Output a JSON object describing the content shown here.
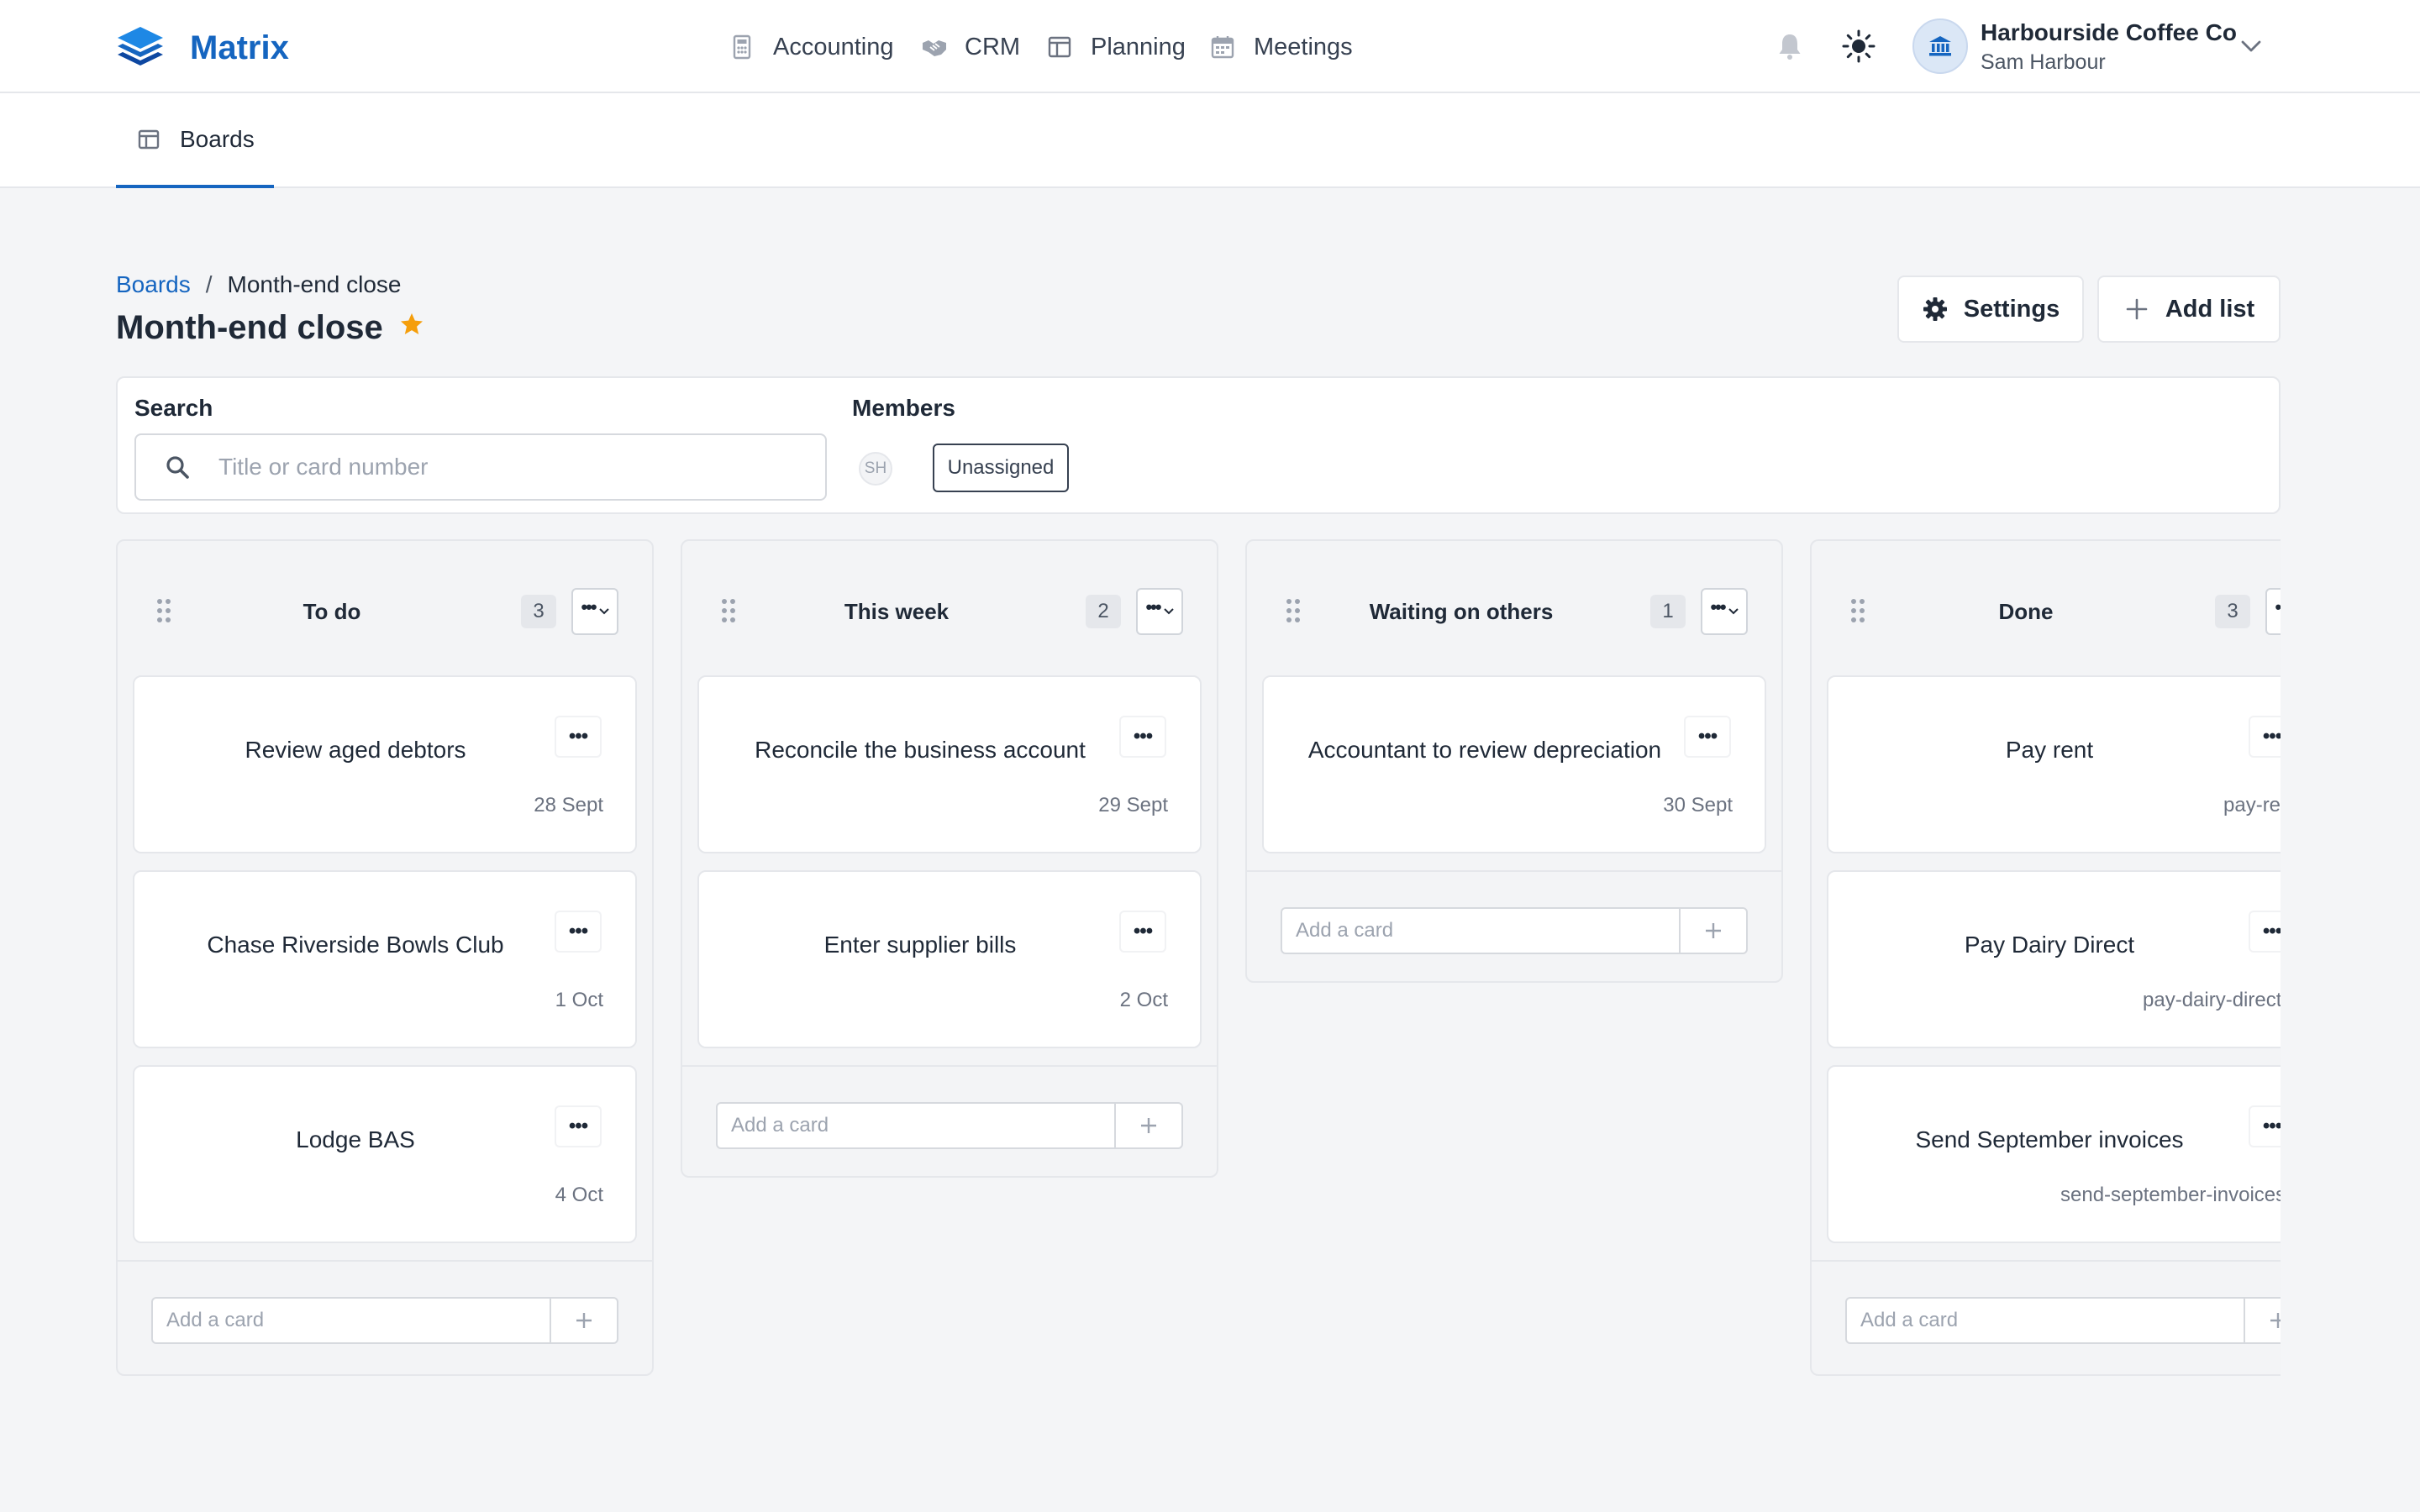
{
  "app": {
    "brand": "Matrix",
    "nav": [
      {
        "label": "Accounting",
        "icon": "calculator-icon"
      },
      {
        "label": "CRM",
        "icon": "handshake-icon"
      },
      {
        "label": "Planning",
        "icon": "layout-icon"
      },
      {
        "label": "Meetings",
        "icon": "calendar-icon"
      }
    ],
    "account": {
      "org": "Harbourside Coffee Co",
      "user": "Sam Harbour"
    }
  },
  "subnav": {
    "active_tab": "Boards"
  },
  "breadcrumb": {
    "parent": "Boards",
    "separator": "/",
    "current": "Month-end close"
  },
  "page": {
    "title": "Month-end close",
    "starred": true,
    "settings_label": "Settings",
    "add_list_label": "Add list"
  },
  "filters": {
    "search_label": "Search",
    "search_placeholder": "Title or card number",
    "members_label": "Members",
    "member_initials": "SH",
    "unassigned_label": "Unassigned"
  },
  "add_card_placeholder": "Add a card",
  "columns": [
    {
      "title": "To do",
      "count": "3",
      "cards": [
        {
          "title": "Review aged debtors",
          "meta": "28 Sept"
        },
        {
          "title": "Chase Riverside Bowls Club",
          "meta": "1 Oct"
        },
        {
          "title": "Lodge BAS",
          "meta": "4 Oct"
        }
      ]
    },
    {
      "title": "This week",
      "count": "2",
      "cards": [
        {
          "title": "Reconcile the business account",
          "meta": "29 Sept"
        },
        {
          "title": "Enter supplier bills",
          "meta": "2 Oct"
        }
      ]
    },
    {
      "title": "Waiting on others",
      "count": "1",
      "cards": [
        {
          "title": "Accountant to review depreciation",
          "meta": "30 Sept"
        }
      ]
    },
    {
      "title": "Done",
      "count": "3",
      "cards": [
        {
          "title": "Pay rent",
          "meta": "pay-rent"
        },
        {
          "title": "Pay Dairy Direct",
          "meta": "pay-dairy-direct"
        },
        {
          "title": "Send September invoices",
          "meta": "send-september-invoices"
        }
      ]
    }
  ],
  "colors": {
    "brand": "#1565c0",
    "star": "#f59e0b",
    "text": "#1f2937",
    "muted": "#9ca3af"
  }
}
